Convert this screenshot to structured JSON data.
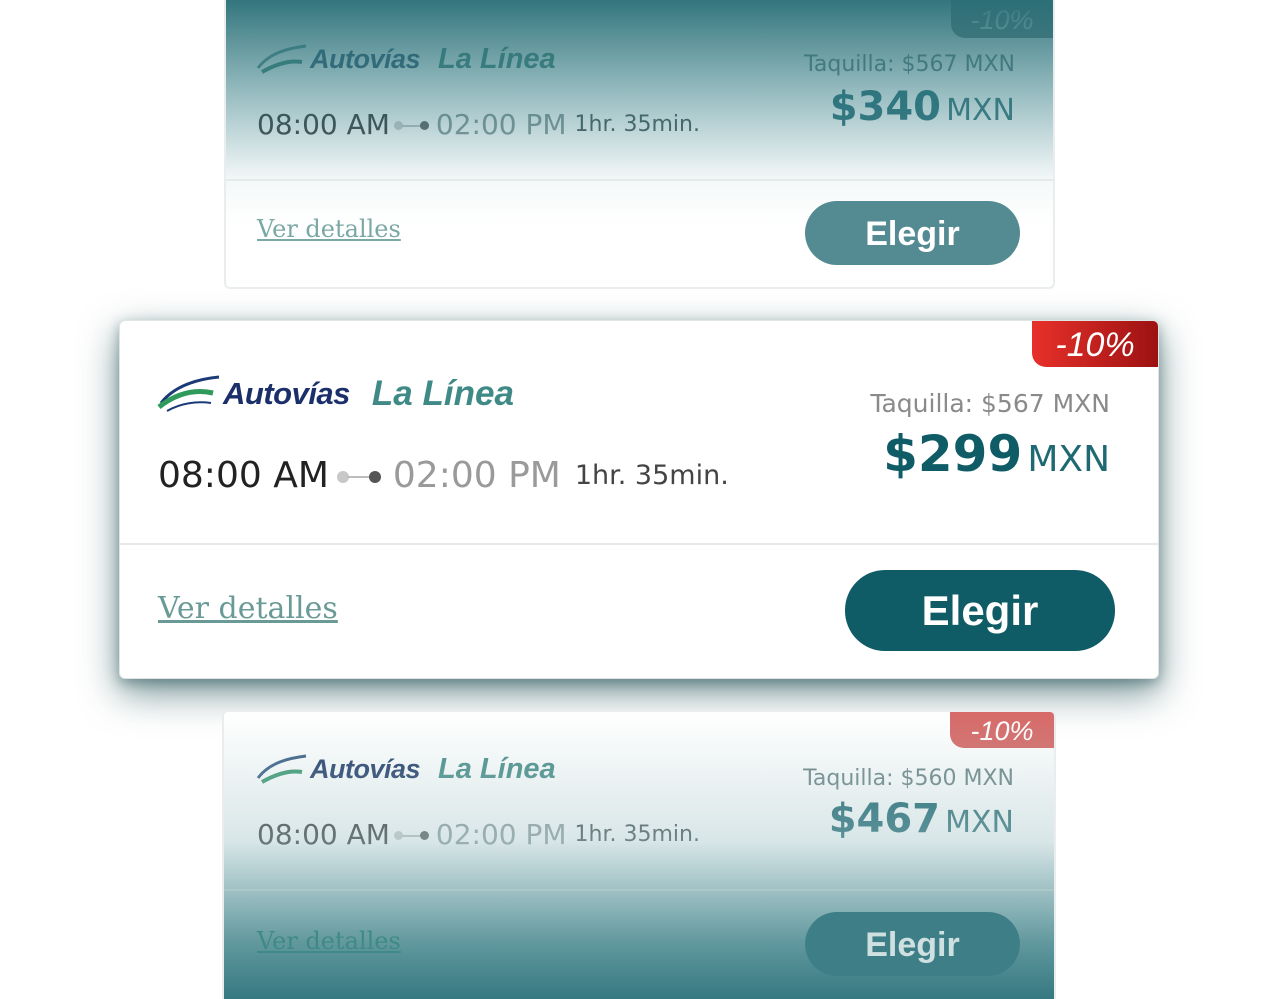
{
  "cards": [
    {
      "badge": "-10%",
      "brand_primary": "Autovías",
      "brand_secondary": "La Línea",
      "departure": "08:00 AM",
      "arrival": "02:00 PM",
      "duration": "1hr. 35min.",
      "box_office": "Taquilla: $567 MXN",
      "price": "$340",
      "currency": "MXN",
      "details_link": "Ver detalles",
      "choose_label": "Elegir"
    },
    {
      "badge": "-10%",
      "brand_primary": "Autovías",
      "brand_secondary": "La Línea",
      "departure": "08:00 AM",
      "arrival": "02:00 PM",
      "duration": "1hr. 35min.",
      "box_office": "Taquilla: $567 MXN",
      "price": "$299",
      "currency": "MXN",
      "details_link": "Ver detalles",
      "choose_label": "Elegir"
    },
    {
      "badge": "-10%",
      "brand_primary": "Autovías",
      "brand_secondary": "La Línea",
      "departure": "08:00 AM",
      "arrival": "02:00 PM",
      "duration": "1hr. 35min.",
      "box_office": "Taquilla: $560 MXN",
      "price": "$467",
      "currency": "MXN",
      "details_link": "Ver detalles",
      "choose_label": "Elegir"
    }
  ],
  "colors": {
    "accent": "#0f5c66",
    "badge_red": "#d8221f",
    "badge_dark": "#8a1010",
    "link": "#6a9a95",
    "brand_navy": "#1b2f6a",
    "brand_teal": "#3f8a86"
  },
  "icons": [
    "autovias-swoosh-logo-icon",
    "route-dots-icon"
  ]
}
